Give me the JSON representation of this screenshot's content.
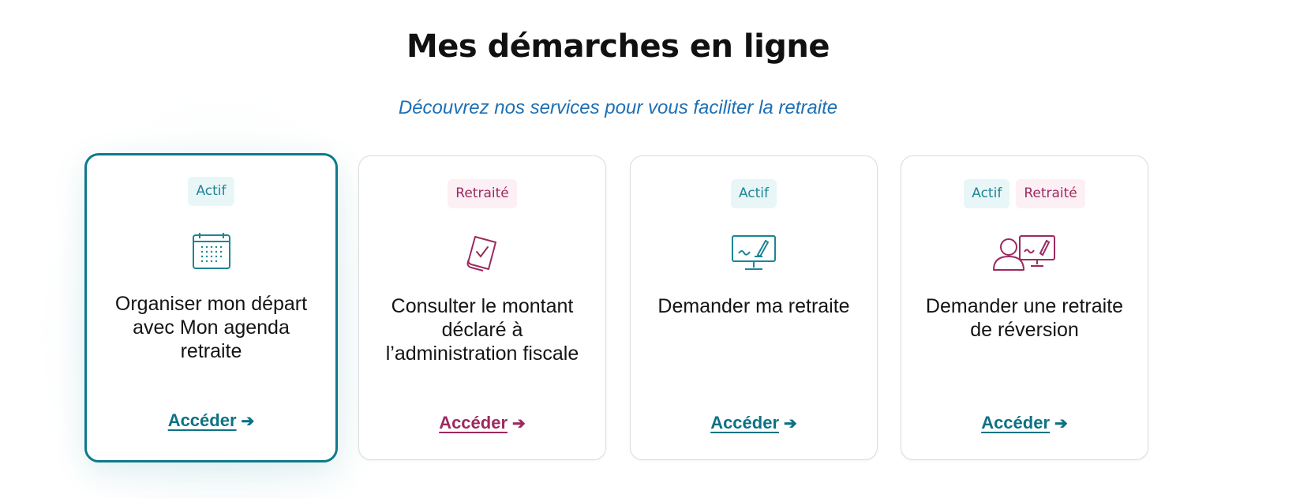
{
  "header": {
    "title": "Mes démarches en ligne",
    "subtitle": "Découvrez nos services pour vous faciliter la retraite"
  },
  "cards": [
    {
      "tags": [
        "Actif"
      ],
      "icon": "calendar-icon",
      "title": "Organiser mon départ avec Mon agenda retraite",
      "cta": "Accéder"
    },
    {
      "tags": [
        "Retraité"
      ],
      "icon": "signed-document-icon",
      "title": "Consulter le montant déclaré à l’administration fiscale",
      "cta": "Accéder"
    },
    {
      "tags": [
        "Actif"
      ],
      "icon": "computer-signature-icon",
      "title": "Demander ma retraite",
      "cta": "Accéder"
    },
    {
      "tags": [
        "Actif",
        "Retraité"
      ],
      "icon": "person-computer-icon",
      "title": "Demander une retraite de réversion",
      "cta": "Accéder"
    }
  ],
  "colors": {
    "teal": "#0c7a8c",
    "pink": "#9c2a5f",
    "subtitle_blue": "#1d6fb5"
  },
  "cta_arrow": "arrow-right-icon"
}
